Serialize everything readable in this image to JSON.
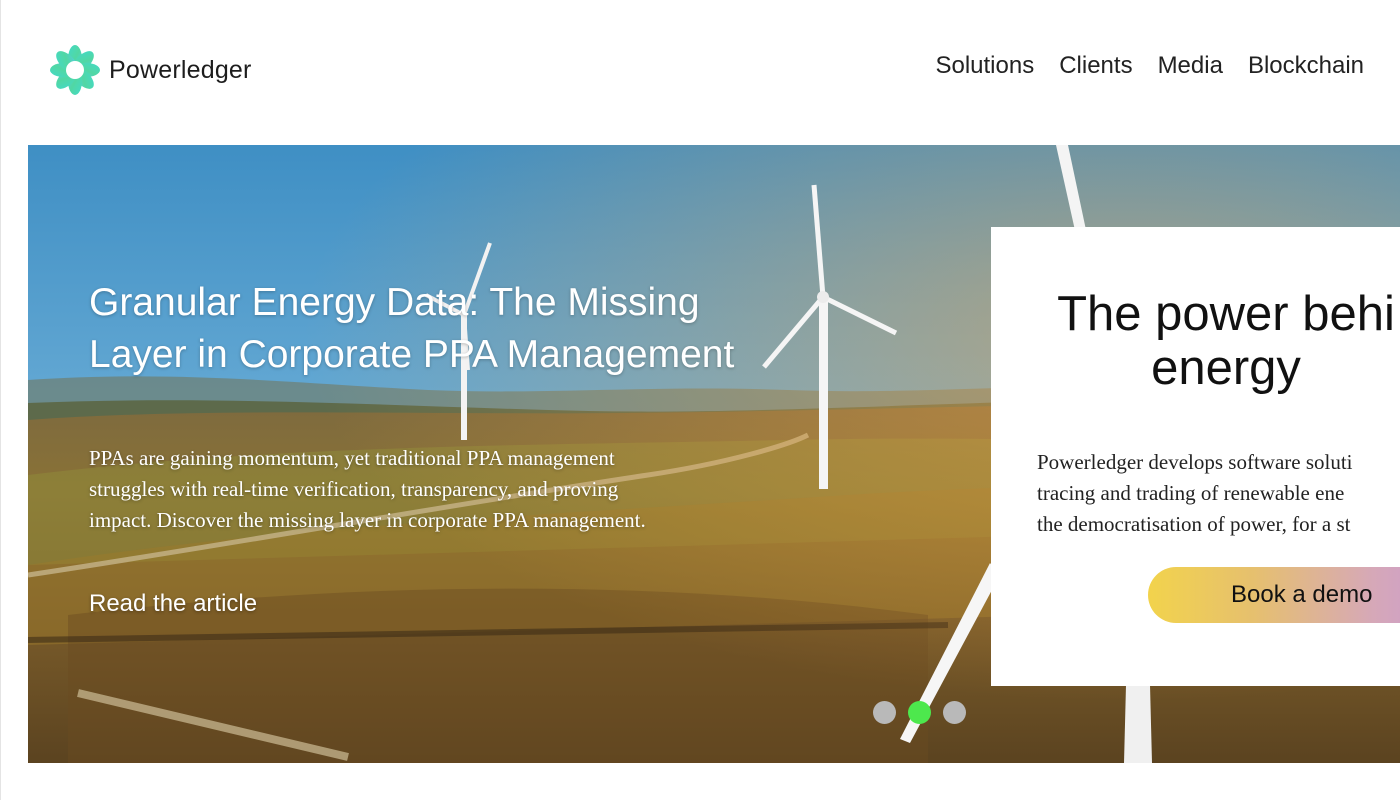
{
  "header": {
    "brand": "Powerledger",
    "logo_icon": "powerledger-flower-icon",
    "nav": [
      "Solutions",
      "Clients",
      "Media",
      "Blockchain"
    ]
  },
  "hero": {
    "slide": {
      "title_line1": "Granular Energy Data: The Missing",
      "title_line2": "Layer in Corporate PPA Management",
      "desc_line1": "PPAs are gaining momentum, yet traditional PPA management",
      "desc_line2": "struggles with real-time verification, transparency, and proving",
      "desc_line3": "impact. Discover the missing layer in corporate PPA management.",
      "link": "Read the article"
    },
    "carousel": {
      "count": 3,
      "active_index": 1,
      "active_color": "#4de84d",
      "inactive_color": "#b9b9b9"
    }
  },
  "card": {
    "title_line1": "The power behi",
    "title_line2": "energy",
    "desc_line1": "Powerledger develops software soluti",
    "desc_line2": "tracing and trading of renewable ene",
    "desc_line3": "the democratisation of power, for a st",
    "button": "Book a demo"
  },
  "colors": {
    "button_gradient": [
      "#f2d34c",
      "#d6a8b8",
      "#c99ad0"
    ],
    "active_dot": "#4de84d"
  }
}
